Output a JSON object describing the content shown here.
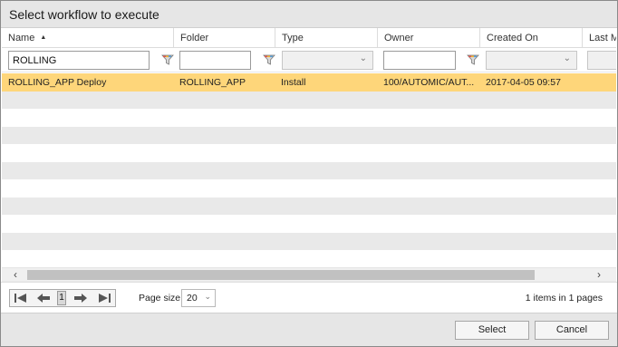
{
  "dialog": {
    "title": "Select workflow to execute"
  },
  "columns": [
    {
      "label": "Name",
      "sorted": "ascending"
    },
    {
      "label": "Folder"
    },
    {
      "label": "Type"
    },
    {
      "label": "Owner"
    },
    {
      "label": "Created On"
    },
    {
      "label": "Last Mo"
    }
  ],
  "filters": {
    "name_value": "ROLLING",
    "folder_value": "",
    "owner_value": ""
  },
  "rows": [
    {
      "name": "ROLLING_APP Deploy",
      "folder": "ROLLING_APP",
      "type": "Install",
      "owner": "100/AUTOMIC/AUT...",
      "created_on": "2017-04-05 09:57",
      "selected": true
    }
  ],
  "pager": {
    "current_page": "1",
    "page_size_label": "Page size:",
    "page_size_value": "20",
    "info": "1 items in 1 pages"
  },
  "buttons": {
    "select": "Select",
    "cancel": "Cancel"
  },
  "colors": {
    "selected_row": "#fed67a",
    "alt_row": "#e9e9e9",
    "titlebar": "#e6e6e6"
  },
  "icons": [
    "sort-ascending-icon",
    "filter-funnel-icon",
    "chevron-down-icon",
    "scroll-left-icon",
    "scroll-right-icon",
    "first-page-icon",
    "prev-page-icon",
    "next-page-icon",
    "last-page-icon"
  ]
}
